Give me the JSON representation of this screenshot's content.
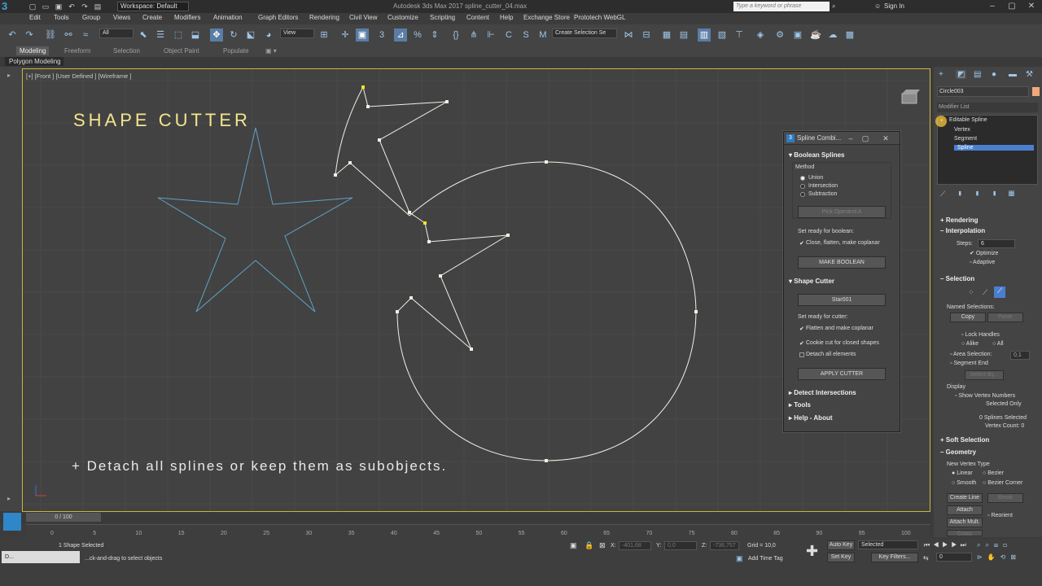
{
  "titlebar": {
    "workspace": "Workspace: Default",
    "app_title": "Autodesk 3ds Max 2017    spline_cutter_04.max",
    "search_placeholder": "Type a keyword or phrase",
    "sign_in": "Sign In"
  },
  "menu": [
    "Edit",
    "Tools",
    "Group",
    "Views",
    "Create",
    "Modifiers",
    "Animation",
    "Graph Editors",
    "Rendering",
    "Civil View",
    "Customize",
    "Scripting",
    "Content",
    "Help",
    "Exchange Store",
    "Prototech WebGL"
  ],
  "toolbar": {
    "filter": "All",
    "view": "View",
    "selection_set": "Create Selection Se"
  },
  "ribbon": {
    "tabs": [
      "Modeling",
      "Freeform",
      "Selection",
      "Object Paint",
      "Populate"
    ],
    "active_tab": "Modeling",
    "sub": "Polygon Modeling"
  },
  "viewport": {
    "label": "[+] [Front ] [User Defined ] [Wireframe ]",
    "heading": "SHAPE CUTTER",
    "caption": "+ Detach all splines or keep them as subobjects."
  },
  "dialog": {
    "title": "Spline Combi...",
    "boolean_section": "Boolean Splines",
    "method_label": "Method",
    "methods": [
      "Union",
      "Intersection",
      "Subtraction"
    ],
    "selected_method": "Union",
    "pick_operand": "Pick Operand A",
    "ready_boolean": "Set ready for boolean:",
    "close_flatten": "Close, flatten, make coplanar",
    "make_boolean": "MAKE BOOLEAN",
    "cutter_section": "Shape Cutter",
    "cutter_object": "Star001",
    "ready_cutter": "Set ready for cutter:",
    "flatten": "Flatten and make coplanar",
    "cookie_cut": "Cookie cut for closed shapes",
    "detach_all": "Detach all elements",
    "apply_cutter": "APPLY CUTTER",
    "detect_section": "Detect Intersections",
    "tools_section": "Tools",
    "help_section": "Help - About"
  },
  "command_panel": {
    "object_name": "Circle003",
    "modifier_list": "Modifier List",
    "stack": [
      "Editable Spline",
      "Vertex",
      "Segment",
      "Spline"
    ],
    "stack_selected": "Spline",
    "rendering": "Rendering",
    "interpolation": "Interpolation",
    "steps_label": "Steps:",
    "steps_value": "6",
    "optimize": "Optimize",
    "adaptive": "Adaptive",
    "selection": "Selection",
    "named_selections": "Named Selections:",
    "copy": "Copy",
    "paste": "Paste",
    "lock_handles": "Lock Handles",
    "alike": "Alike",
    "all": "All",
    "area_selection": "Area Selection:",
    "area_value": "0,1",
    "segment_end": "Segment End",
    "select_by": "Select By...",
    "display": "Display",
    "show_vertex_numbers": "Show Vertex Numbers",
    "selected_only": "Selected Only",
    "splines_selected": "0 Splines Selected",
    "vertex_count": "Vertex Count: 0",
    "soft_selection": "Soft Selection",
    "geometry": "Geometry",
    "new_vertex_type": "New Vertex Type",
    "vertex_types": [
      "Linear",
      "Bezier",
      "Smooth",
      "Bezier Corner"
    ],
    "create_line": "Create Line",
    "break": "Break",
    "attach": "Attach",
    "attach_mult": "Attach Mult.",
    "reorient": "Reorient",
    "cross_section": "Cross Section"
  },
  "timeline": {
    "slider": "0 / 100",
    "ticks": [
      "0",
      "5",
      "10",
      "15",
      "20",
      "25",
      "30",
      "35",
      "40",
      "45",
      "50",
      "55",
      "60",
      "65",
      "70",
      "75",
      "80",
      "85",
      "90",
      "95",
      "100"
    ]
  },
  "status": {
    "script_label": "D...",
    "shape_selected": "1 Shape Selected",
    "prompt": "...ck-and-drag to select objects",
    "x_label": "X:",
    "x_value": "-401,68",
    "y_label": "Y:",
    "y_value": "0,0",
    "z_label": "Z:",
    "z_value": "-736,757",
    "grid": "Grid = 10,0",
    "add_time_tag": "Add Time Tag",
    "auto_key": "Auto Key",
    "set_key": "Set Key",
    "selected": "Selected",
    "key_filters": "Key Filters...",
    "frame": "0"
  },
  "colors": {
    "accent": "#c9b53d",
    "selection": "#4a7fd0",
    "star": "#5fa2c6",
    "heading": "#f3e58e"
  }
}
